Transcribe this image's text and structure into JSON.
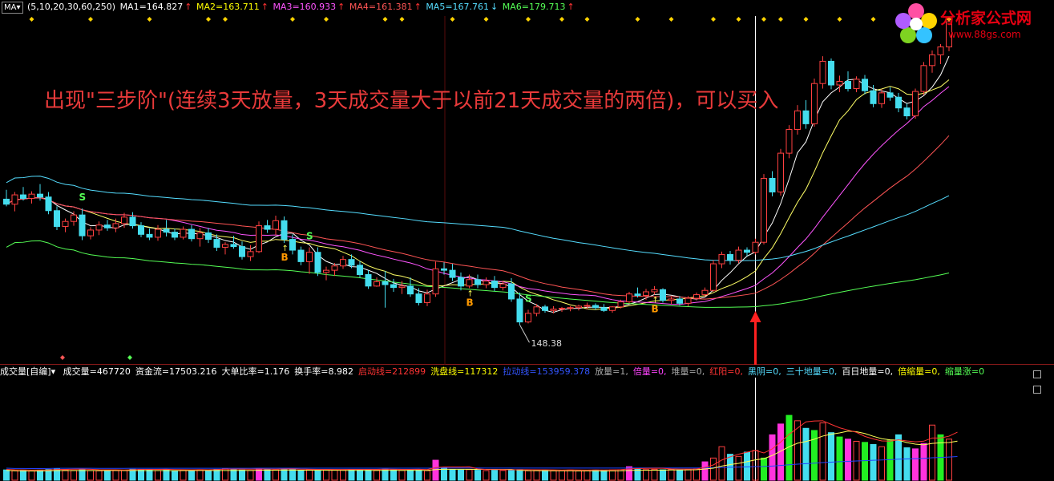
{
  "top_indicator": {
    "menu_label": "MA▾",
    "params": "(5,10,20,30,60,250)",
    "ma1": {
      "label": "MA1=164.827",
      "color": "#ffffff"
    },
    "ma2": {
      "label": "MA2=163.711",
      "color": "#ffff00"
    },
    "ma3": {
      "label": "MA3=160.933",
      "color": "#ff55ff"
    },
    "ma4": {
      "label": "MA4=161.381",
      "color": "#ff5555"
    },
    "ma5": {
      "label": "MA5=167.761",
      "color": "#55ddff"
    },
    "ma6": {
      "label": "MA6=179.713",
      "color": "#55ff55"
    },
    "up_arrow": "↑",
    "down_arrow": "↓"
  },
  "annotation": "出现\"三步阶\"(连续3天放量，3天成交量大于以前21天成交量的两倍)，可以买入",
  "logo": {
    "text": "分析家公式网",
    "url": "www.88gs.com"
  },
  "volume_indicator": {
    "name": "成交量[自编]▾",
    "items": [
      {
        "text": "成交量=467720",
        "color": "#ffffff"
      },
      {
        "text": "资金流=17503.216",
        "color": "#ffffff"
      },
      {
        "text": "大单比率=1.176",
        "color": "#ffffff"
      },
      {
        "text": "换手率=8.982",
        "color": "#ffffff"
      },
      {
        "text": "启动线=212899",
        "color": "#ff3333"
      },
      {
        "text": "洗盘线=117312",
        "color": "#ffff00"
      },
      {
        "text": "拉动线=153959.378",
        "color": "#3355ff"
      },
      {
        "text": "放量=1,",
        "color": "#aaaaaa"
      },
      {
        "text": "倍量=0,",
        "color": "#ff44ff"
      },
      {
        "text": "堆量=0,",
        "color": "#aaaaaa"
      },
      {
        "text": "红阳=0,",
        "color": "#ff3333"
      },
      {
        "text": "黑阴=0,",
        "color": "#55ddff"
      },
      {
        "text": "三十地量=0,",
        "color": "#55ddff"
      },
      {
        "text": "百日地量=0,",
        "color": "#ffffff"
      },
      {
        "text": "倍缩量=0,",
        "color": "#ffff00"
      },
      {
        "text": "缩量涨=0",
        "color": "#55ff55"
      }
    ]
  },
  "chart_data": [
    {
      "type": "candlestick",
      "title": "",
      "x_count": 96,
      "ylim": [
        140,
        188
      ],
      "ohlc": [
        [
          162.5,
          163.8,
          161.5,
          161.8
        ],
        [
          161.8,
          163.5,
          160.8,
          163.1
        ],
        [
          163.1,
          164.2,
          162.3,
          162.6
        ],
        [
          162.6,
          163.6,
          161.9,
          163.2
        ],
        [
          163.2,
          164.6,
          162.3,
          162.8
        ],
        [
          162.8,
          163.5,
          160.4,
          160.9
        ],
        [
          160.9,
          161.5,
          158.2,
          158.7
        ],
        [
          158.7,
          159.8,
          157.9,
          159.4
        ],
        [
          159.4,
          160.8,
          158.8,
          160.3
        ],
        [
          160.3,
          161.2,
          156.8,
          157.4
        ],
        [
          157.4,
          158.6,
          156.9,
          158.2
        ],
        [
          158.2,
          159.4,
          157.5,
          158.9
        ],
        [
          158.9,
          159.6,
          158.1,
          158.5
        ],
        [
          158.5,
          159.8,
          157.9,
          159.1
        ],
        [
          159.1,
          160.6,
          158.5,
          160.0
        ],
        [
          160.0,
          160.7,
          158.4,
          158.8
        ],
        [
          158.8,
          159.3,
          157.2,
          157.6
        ],
        [
          157.6,
          158.4,
          156.8,
          157.2
        ],
        [
          157.2,
          158.9,
          156.7,
          158.3
        ],
        [
          158.3,
          159.6,
          157.3,
          157.9
        ],
        [
          157.9,
          158.4,
          156.8,
          157.2
        ],
        [
          157.2,
          158.7,
          156.9,
          158.3
        ],
        [
          158.3,
          158.9,
          156.6,
          157.0
        ],
        [
          157.0,
          158.5,
          155.9,
          157.8
        ],
        [
          157.8,
          158.5,
          156.4,
          156.9
        ],
        [
          156.9,
          157.6,
          155.3,
          155.8
        ],
        [
          155.8,
          156.5,
          154.8,
          156.2
        ],
        [
          156.2,
          157.4,
          155.6,
          155.9
        ],
        [
          155.9,
          156.6,
          154.1,
          154.5
        ],
        [
          154.5,
          156.1,
          153.9,
          155.2
        ],
        [
          155.2,
          159.4,
          155.0,
          158.8
        ],
        [
          158.8,
          159.6,
          157.8,
          158.3
        ],
        [
          158.3,
          160.2,
          157.5,
          159.5
        ],
        [
          159.5,
          160.1,
          156.4,
          156.9
        ],
        [
          156.9,
          157.6,
          154.8,
          155.4
        ],
        [
          155.4,
          155.9,
          153.3,
          153.8
        ],
        [
          153.8,
          155.8,
          152.1,
          155.1
        ],
        [
          155.1,
          155.8,
          151.8,
          152.3
        ],
        [
          152.3,
          153.1,
          151.2,
          152.6
        ],
        [
          152.6,
          153.6,
          151.8,
          153.2
        ],
        [
          153.2,
          154.6,
          152.8,
          154.1
        ],
        [
          154.1,
          154.8,
          152.9,
          153.3
        ],
        [
          153.3,
          153.9,
          151.6,
          152.0
        ],
        [
          152.0,
          152.6,
          150.0,
          150.4
        ],
        [
          150.4,
          151.6,
          150.3,
          151.0
        ],
        [
          151.0,
          152.5,
          147.4,
          150.6
        ],
        [
          150.6,
          151.4,
          149.6,
          150.2
        ],
        [
          150.2,
          151.1,
          149.3,
          150.4
        ],
        [
          150.4,
          151.6,
          148.9,
          149.3
        ],
        [
          149.3,
          150.1,
          147.7,
          148.1
        ],
        [
          148.1,
          149.9,
          147.6,
          149.3
        ],
        [
          149.3,
          153.8,
          148.9,
          152.8
        ],
        [
          152.8,
          153.7,
          152.0,
          152.6
        ],
        [
          152.6,
          153.5,
          151.1,
          151.6
        ],
        [
          151.6,
          152.3,
          149.8,
          150.4
        ],
        [
          150.4,
          152.0,
          150.1,
          151.3
        ],
        [
          151.3,
          152.0,
          150.1,
          150.6
        ],
        [
          150.6,
          151.6,
          150.1,
          151.1
        ],
        [
          151.1,
          151.8,
          149.7,
          150.2
        ],
        [
          150.2,
          151.1,
          149.8,
          150.7
        ],
        [
          150.7,
          151.5,
          148.2,
          148.6
        ],
        [
          148.6,
          149.5,
          145.0,
          145.4
        ],
        [
          145.4,
          147.1,
          145.2,
          146.6
        ],
        [
          146.6,
          147.9,
          146.2,
          147.5
        ],
        [
          147.5,
          147.8,
          146.7,
          147.0
        ],
        [
          147.0,
          147.6,
          146.6,
          147.2
        ],
        [
          147.2,
          147.5,
          146.8,
          147.3
        ],
        [
          147.3,
          147.6,
          146.9,
          147.4
        ],
        [
          147.4,
          147.8,
          147.0,
          147.6
        ],
        [
          147.6,
          148.1,
          147.2,
          147.7
        ],
        [
          147.7,
          148.0,
          147.1,
          147.4
        ],
        [
          147.4,
          147.9,
          146.8,
          147.0
        ],
        [
          147.0,
          147.6,
          146.7,
          147.5
        ],
        [
          147.5,
          148.5,
          147.3,
          148.2
        ],
        [
          148.2,
          149.6,
          148.0,
          149.3
        ],
        [
          149.3,
          150.2,
          148.8,
          149.1
        ],
        [
          149.1,
          150.0,
          148.5,
          149.6
        ],
        [
          149.6,
          150.4,
          149.2,
          149.9
        ],
        [
          149.9,
          150.1,
          148.1,
          148.4
        ],
        [
          148.4,
          149.0,
          147.9,
          148.6
        ],
        [
          148.6,
          149.0,
          147.7,
          148.0
        ],
        [
          148.0,
          149.0,
          147.6,
          148.7
        ],
        [
          148.7,
          149.5,
          148.4,
          149.2
        ],
        [
          149.2,
          150.2,
          148.9,
          149.8
        ],
        [
          149.8,
          154.0,
          149.6,
          153.5
        ],
        [
          153.5,
          155.2,
          152.9,
          154.8
        ],
        [
          154.8,
          155.3,
          153.4,
          154.0
        ],
        [
          154.0,
          155.9,
          153.6,
          155.4
        ],
        [
          155.4,
          155.8,
          154.6,
          155.1
        ],
        [
          155.1,
          157.0,
          154.8,
          156.5
        ],
        [
          156.5,
          166.0,
          156.2,
          165.4
        ],
        [
          165.4,
          166.4,
          162.9,
          163.5
        ],
        [
          163.5,
          169.5,
          163.0,
          168.9
        ],
        [
          168.9,
          172.8,
          168.2,
          172.2
        ],
        [
          172.2,
          175.6,
          171.5,
          174.8
        ],
        [
          174.8,
          176.3,
          172.3,
          173.0
        ],
        [
          173.0,
          179.3,
          172.6,
          178.6
        ],
        [
          178.6,
          182.4,
          177.9,
          181.7
        ],
        [
          181.7,
          182.1,
          177.8,
          178.4
        ],
        [
          178.4,
          179.7,
          177.4,
          178.9
        ],
        [
          178.9,
          180.3,
          177.5,
          177.9
        ],
        [
          177.9,
          179.6,
          177.4,
          179.2
        ],
        [
          179.2,
          179.8,
          177.1,
          177.6
        ],
        [
          177.6,
          178.4,
          175.3,
          175.8
        ],
        [
          175.8,
          177.8,
          175.2,
          177.3
        ],
        [
          177.3,
          178.1,
          176.2,
          176.7
        ],
        [
          176.7,
          177.3,
          174.6,
          175.2
        ],
        [
          175.2,
          175.8,
          173.6,
          174.1
        ],
        [
          174.1,
          177.9,
          173.7,
          177.5
        ],
        [
          177.5,
          181.6,
          177.0,
          181.1
        ],
        [
          181.1,
          183.2,
          180.1,
          182.6
        ],
        [
          182.6,
          184.1,
          181.3,
          183.7
        ],
        [
          183.7,
          187.8,
          183.1,
          187.2
        ]
      ]
    },
    {
      "type": "bar",
      "title": "成交量",
      "ylim": [
        0,
        1000000
      ],
      "values": [
        95000,
        88000,
        90000,
        85000,
        93000,
        99000,
        105000,
        96000,
        91000,
        98000,
        90000,
        87000,
        94000,
        89000,
        92000,
        101000,
        99000,
        95000,
        90000,
        96000,
        88000,
        93000,
        91000,
        97000,
        92000,
        100000,
        104000,
        98000,
        94000,
        90000,
        108000,
        99000,
        95000,
        102000,
        97000,
        93000,
        96000,
        91000,
        98000,
        95000,
        92000,
        99000,
        94000,
        97000,
        93000,
        101000,
        95000,
        90000,
        99000,
        96000,
        88000,
        185000,
        115000,
        100000,
        94000,
        98000,
        92000,
        89000,
        95000,
        90000,
        93000,
        98000,
        87000,
        92000,
        90000,
        88000,
        91000,
        94000,
        86000,
        89000,
        93000,
        90000,
        95000,
        97000,
        125000,
        104000,
        98000,
        101000,
        96000,
        100000,
        94000,
        99000,
        104000,
        170000,
        205000,
        310000,
        240000,
        220000,
        260000,
        275000,
        205000,
        420000,
        520000,
        600000,
        550000,
        480000,
        460000,
        530000,
        440000,
        400000,
        380000,
        360000,
        350000,
        330000,
        310000,
        370000,
        420000,
        300000,
        290000,
        340000,
        510000,
        420000,
        380000,
        467720
      ]
    }
  ],
  "price_low_label": "148.38",
  "signals": {
    "buy": "B",
    "sell": "S"
  }
}
